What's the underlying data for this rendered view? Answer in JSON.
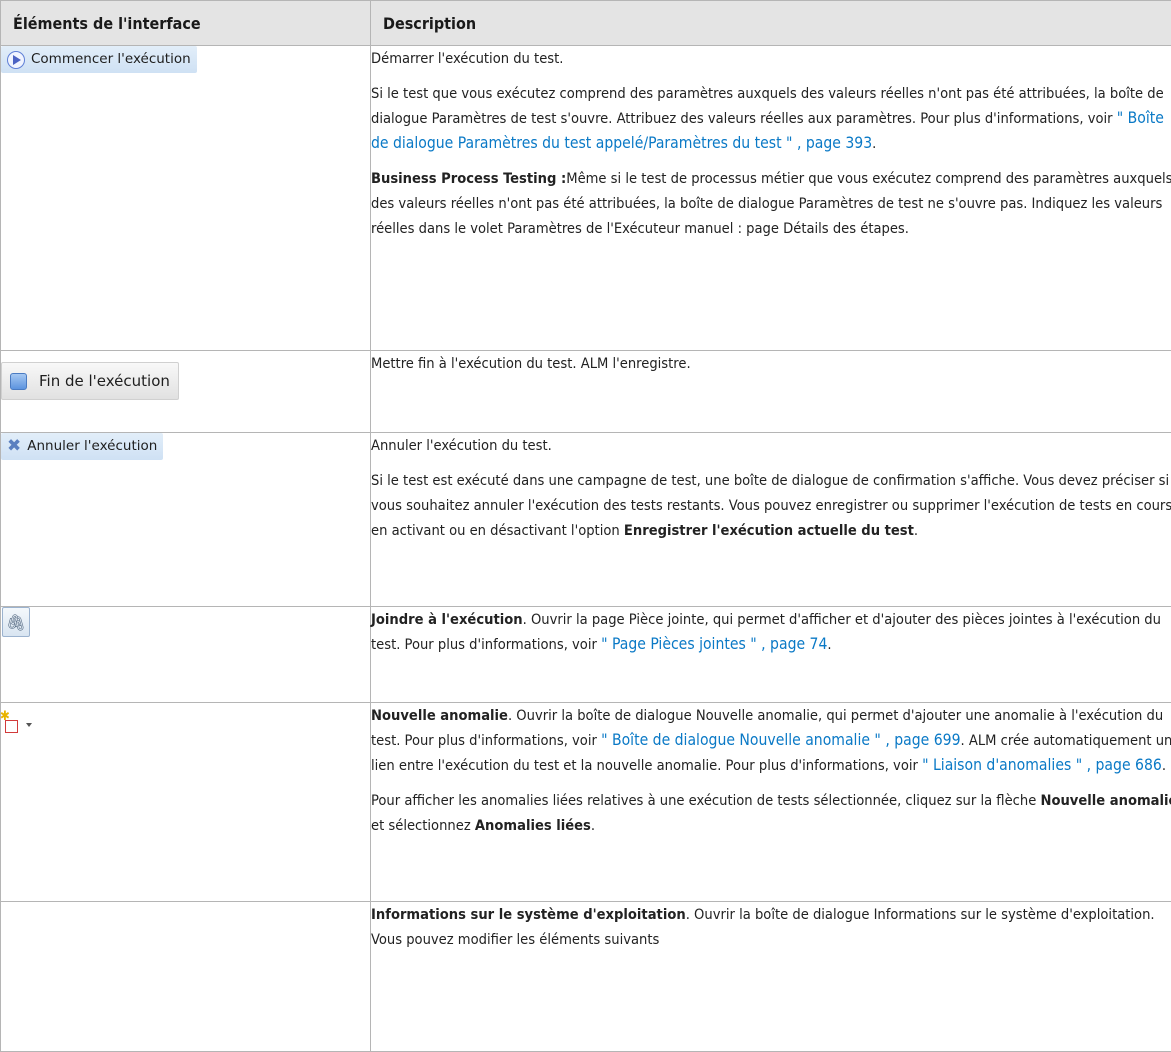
{
  "header": {
    "col_elements": "Éléments de l'interface",
    "col_description": "Description"
  },
  "colors": {
    "link": "#0a79c6",
    "header_bg": "#e4e4e4",
    "border": "#b5b5b5"
  },
  "rows": {
    "start": {
      "button_label": "Commencer l'exécution",
      "icon": "play-circle-icon",
      "p1": "Démarrer l'exécution du test.",
      "p2_text": "Si le test que vous exécutez comprend des paramètres auxquels des valeurs réelles n'ont pas été attribuées, la boîte de dialogue Paramètres de test s'ouvre. Attribuez des valeurs réelles aux paramètres. Pour plus d'informations, voir ",
      "p2_link": "\" Boîte de dialogue Paramètres du test appelé/Paramètres du test \" , page 393",
      "p2_end": ".",
      "p3_bold": "Business Process Testing :",
      "p3_text": "Même si le test de processus métier que vous exécutez comprend des paramètres auxquels des valeurs réelles n'ont pas été attribuées, la boîte de dialogue Paramètres de test ne s'ouvre pas. Indiquez les valeurs réelles dans le volet Paramètres de l'Exécuteur manuel : page Détails des étapes."
    },
    "end": {
      "button_label": "Fin de l'exécution",
      "icon": "stop-square-icon",
      "p1": "Mettre fin à l'exécution du test. ALM l'enregistre."
    },
    "cancel": {
      "button_label": "Annuler l'exécution",
      "icon": "cancel-x-icon",
      "p1": "Annuler l'exécution du test.",
      "p2_text": "Si le test est exécuté dans une campagne de test, une boîte de dialogue de confirmation s'affiche. Vous devez préciser si vous souhaitez annuler l'exécution des tests restants. Vous pouvez enregistrer ou supprimer l'exécution de tests en cours en activant ou en désactivant l'option ",
      "p2_bold": "Enregistrer l'exécution actuelle du test",
      "p2_end": "."
    },
    "attach": {
      "icon": "paperclip-icon",
      "p1_bold": "Joindre à l'exécution",
      "p1_text": ". Ouvrir la page Pièce jointe, qui permet d'afficher et d'ajouter des pièces jointes à l'exécution du test. Pour plus d'informations, voir ",
      "p1_link": "\" Page Pièces jointes \" , page 74",
      "p1_end": "."
    },
    "defect": {
      "icon": "new-defect-icon",
      "p1_bold": "Nouvelle anomalie",
      "p1_text": ". Ouvrir la boîte de dialogue Nouvelle anomalie, qui permet d'ajouter une anomalie à l'exécution du test. Pour plus d'informations, voir ",
      "p1_link": "\" Boîte de dialogue Nouvelle anomalie \" , page 699",
      "p1_mid": ". ALM crée automatiquement un lien entre l'exécution du test et la nouvelle anomalie. Pour plus d'informations, voir ",
      "p1_link2": "\" Liaison d'anomalies \" , page 686",
      "p1_end": ".",
      "p2_text": "Pour afficher les anomalies liées relatives à une exécution de tests sélectionnée, cliquez sur la flèche ",
      "p2_bold1": "Nouvelle anomalie",
      "p2_mid": " et sélectionnez ",
      "p2_bold2": "Anomalies liées",
      "p2_end": "."
    },
    "os": {
      "p1_bold": "Informations sur le système d'exploitation",
      "p1_text": ". Ouvrir la boîte de dialogue Informations sur le système d'exploitation. Vous pouvez modifier les éléments suivants"
    }
  }
}
